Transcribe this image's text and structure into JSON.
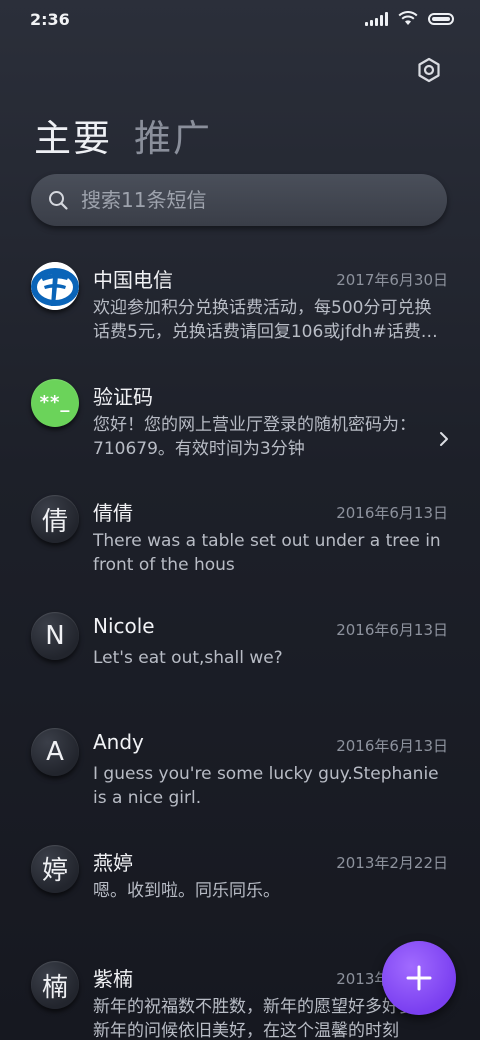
{
  "status_bar": {
    "time": "2:36",
    "icons": [
      "signal-icon",
      "wifi-icon",
      "battery-icon"
    ]
  },
  "header": {
    "settings_icon": "settings-icon",
    "tabs": [
      {
        "label": "主要",
        "active": true
      },
      {
        "label": "推广",
        "active": false
      }
    ]
  },
  "search": {
    "placeholder": "搜索11条短信",
    "icon": "search-icon"
  },
  "conversations": [
    {
      "avatar_text": "",
      "avatar_type": "china-telecom-logo",
      "name": "中国电信",
      "date": "2017年6月30日",
      "preview": "欢迎参加积分兑换话费活动，每500分可兑换话费5元，兑换话费请回复106或jfdh#话费…"
    },
    {
      "avatar_text": "**_",
      "avatar_type": "verification-code",
      "name": "验证码",
      "date": "",
      "preview": "您好！您的网上营业厅登录的随机密码为：710679。有效时间为3分钟"
    },
    {
      "avatar_text": "倩",
      "avatar_type": "letter",
      "name": "倩倩",
      "date": "2016年6月13日",
      "preview": "There was a table set out under a tree in front of the hous"
    },
    {
      "avatar_text": "N",
      "avatar_type": "letter",
      "name": "Nicole",
      "date": "2016年6月13日",
      "preview": "Let's eat out,shall we?"
    },
    {
      "avatar_text": "A",
      "avatar_type": "letter",
      "name": "Andy",
      "date": "2016年6月13日",
      "preview": "I guess you're some lucky guy.Stephanie is a nice girl."
    },
    {
      "avatar_text": "婷",
      "avatar_type": "letter",
      "name": "燕婷",
      "date": "2013年2月22日",
      "preview": "嗯。收到啦。同乐同乐。"
    },
    {
      "avatar_text": "楠",
      "avatar_type": "letter",
      "name": "紫楠",
      "date": "2013年2月22日",
      "preview": "新年的祝福数不胜数，新年的愿望好多好多，新年的问候依旧美好，在这个温馨的时刻"
    }
  ],
  "fab": {
    "icon": "plus-icon"
  },
  "colors": {
    "background": "#1d2029",
    "fab": "#8a4dff",
    "code_avatar": "#6bd35a",
    "telecom_blue": "#0a64b8"
  }
}
